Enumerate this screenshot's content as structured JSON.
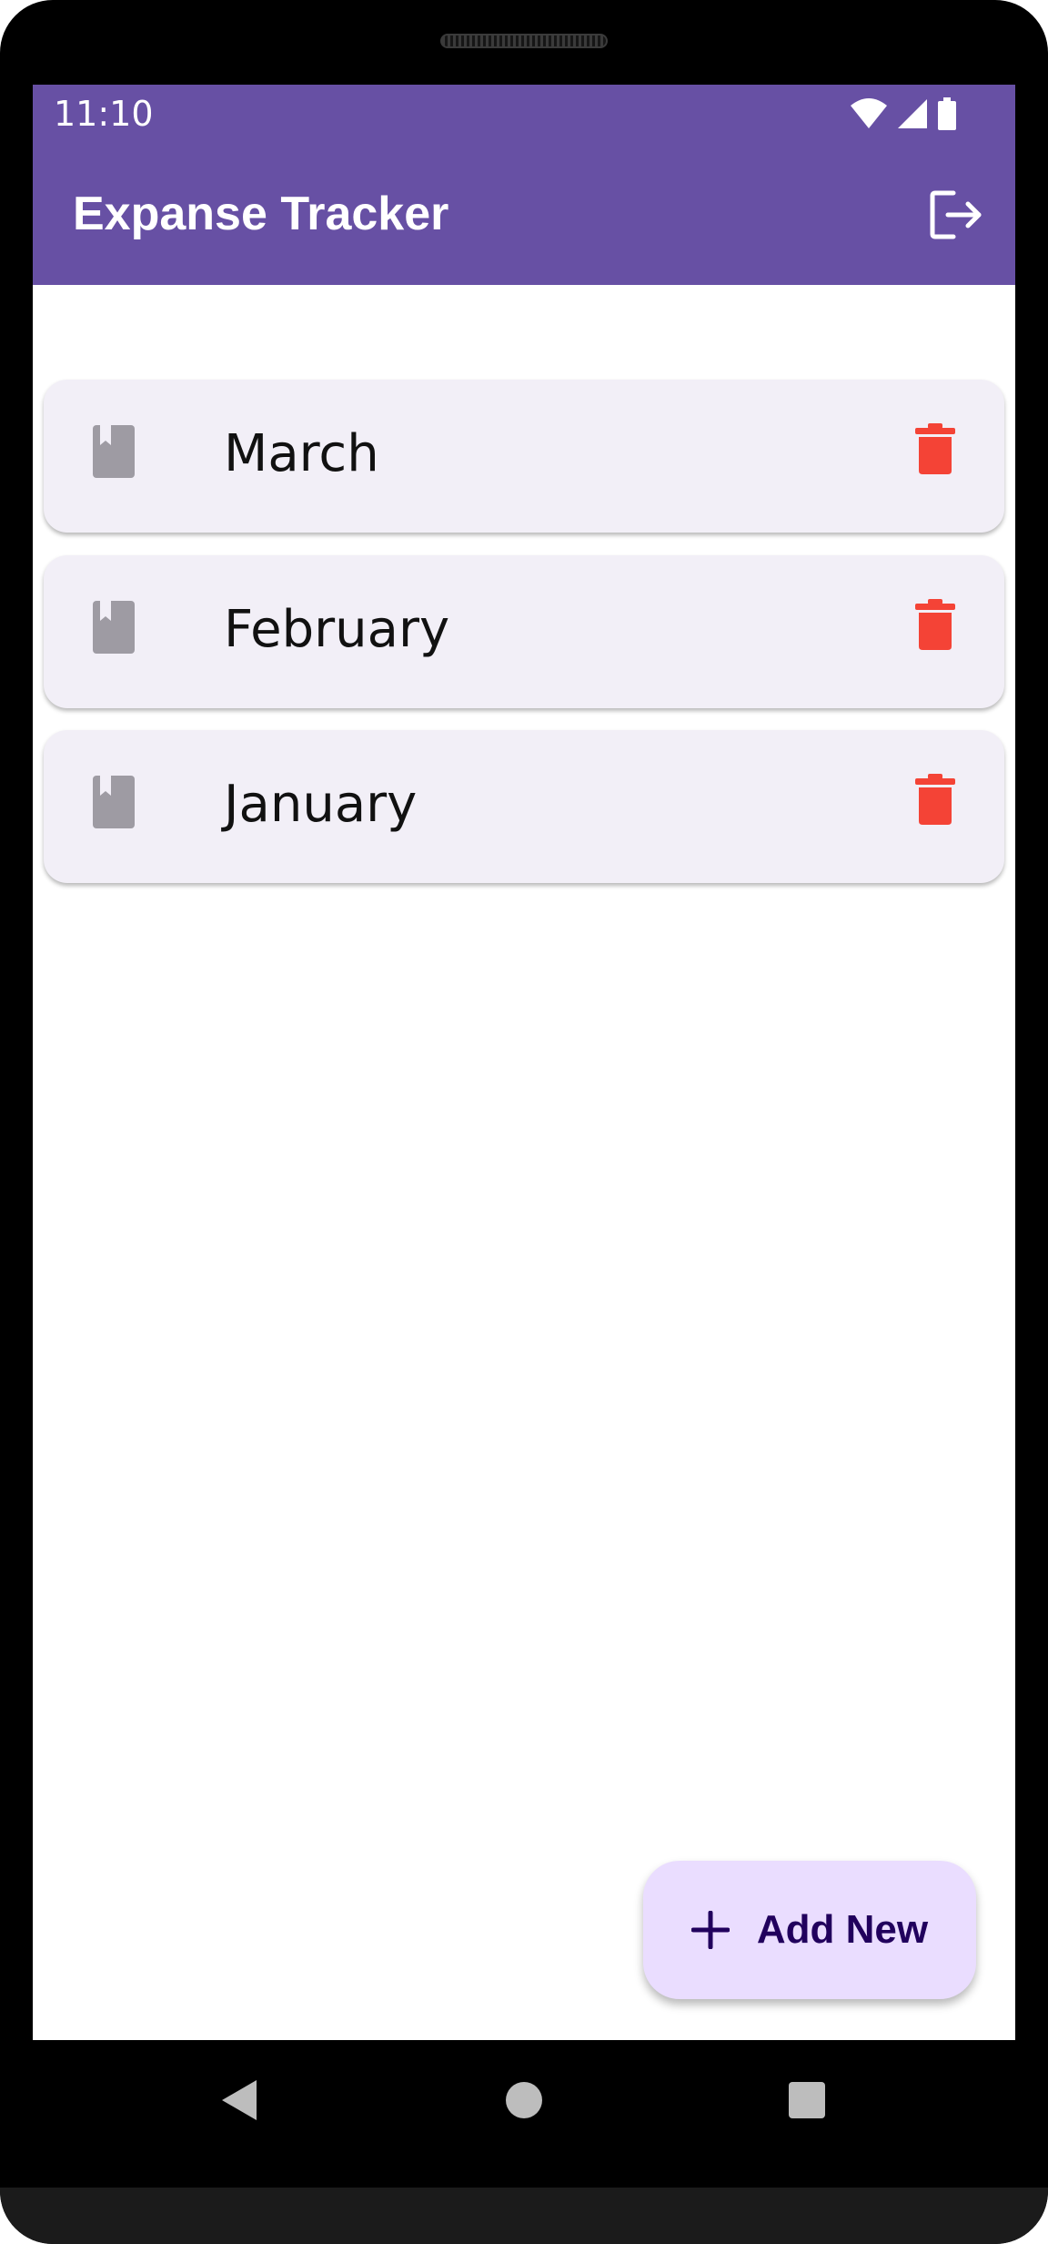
{
  "status_bar": {
    "time": "11:10",
    "icons": [
      "wifi-icon",
      "cellular-signal-icon",
      "battery-icon"
    ]
  },
  "app_bar": {
    "title": "Expanse Tracker",
    "action_icon": "logout-icon"
  },
  "months": [
    {
      "label": "March",
      "icon": "book-icon",
      "delete_icon": "trash-icon"
    },
    {
      "label": "February",
      "icon": "book-icon",
      "delete_icon": "trash-icon"
    },
    {
      "label": "January",
      "icon": "book-icon",
      "delete_icon": "trash-icon"
    }
  ],
  "fab": {
    "label": "Add New",
    "icon": "plus-icon"
  },
  "nav_bar": {
    "icons": [
      "back-icon",
      "home-icon",
      "recents-icon"
    ]
  },
  "colors": {
    "primary": "#6750a4",
    "card_background": "#f2eff7",
    "delete": "#f44336",
    "book_icon": "#9e9ba3",
    "fab_background": "#eaddff",
    "fab_text": "#21005d"
  }
}
